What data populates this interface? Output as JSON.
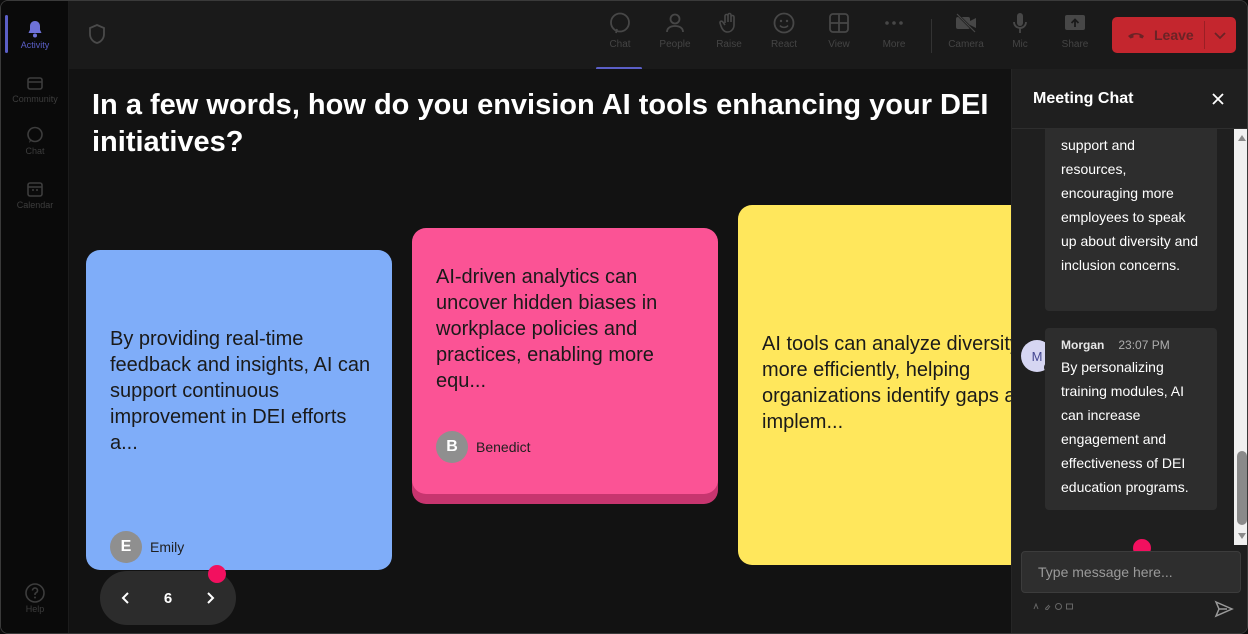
{
  "rail": {
    "items": [
      {
        "label": "Activity",
        "icon": "bell-icon",
        "active": true
      },
      {
        "label": "Community",
        "icon": "community-icon"
      },
      {
        "label": "Chat",
        "icon": "chat-icon"
      },
      {
        "label": "Calendar",
        "icon": "calendar-icon"
      },
      {
        "label": "Help",
        "icon": "help-icon"
      }
    ]
  },
  "toolbar": {
    "buttons": [
      {
        "label": "Chat",
        "icon": "chat-icon",
        "active": true
      },
      {
        "label": "People",
        "icon": "people-icon"
      },
      {
        "label": "Raise",
        "icon": "raise-hand-icon"
      },
      {
        "label": "React",
        "icon": "react-icon"
      },
      {
        "label": "View",
        "icon": "view-grid-icon"
      },
      {
        "label": "More",
        "icon": "more-icon"
      },
      {
        "label": "Camera",
        "icon": "camera-off-icon"
      },
      {
        "label": "Mic",
        "icon": "mic-icon"
      },
      {
        "label": "Share",
        "icon": "share-icon"
      }
    ],
    "leave_label": "Leave",
    "leave_color": "#c4262e"
  },
  "stage": {
    "question": "In a few words, how do you envision AI tools enhancing your DEI initiatives?",
    "cards": [
      {
        "text": "By providing real-time feedback and insights, AI can support continuous improvement in DEI efforts a...",
        "author": "Emily",
        "initial": "E",
        "color": "#7fadf9"
      },
      {
        "text": "AI-driven analytics can uncover hidden biases in workplace policies and practices, enabling more equ...",
        "author": "Benedict",
        "initial": "B",
        "color": "#fb5395"
      },
      {
        "text": "AI tools can analyze diversity data more efficiently, helping organizations identify gaps and implem...",
        "color": "#ffe75c"
      }
    ],
    "page_number": "6"
  },
  "chat": {
    "title": "Meeting Chat",
    "messages": [
      {
        "text": "support and resources, encouraging more employees to speak up about diversity and inclusion concerns."
      },
      {
        "author": "Morgan",
        "initial": "M",
        "time": "23:07 PM",
        "text": "By personalizing training modules, AI can increase engagement and effectiveness of DEI education programs."
      }
    ],
    "input_placeholder": "Type message here..."
  }
}
